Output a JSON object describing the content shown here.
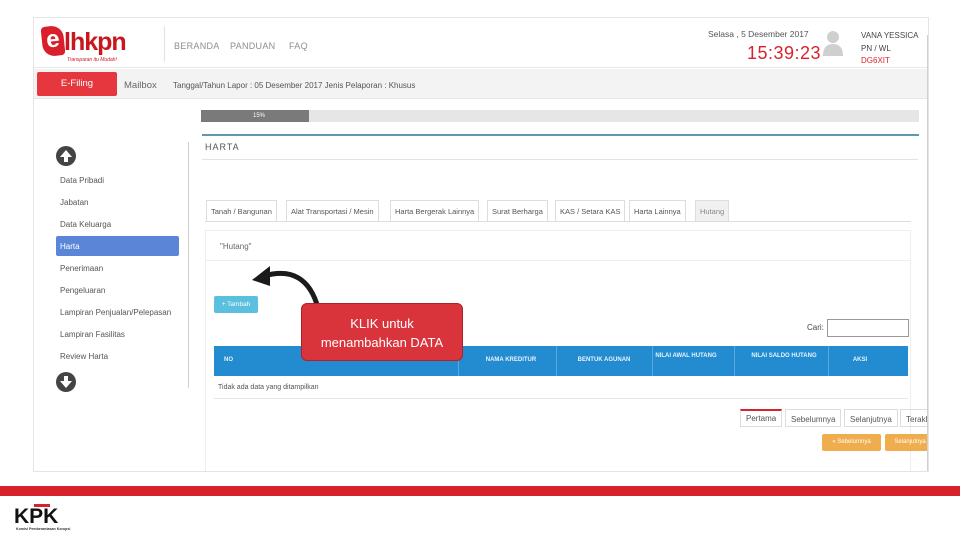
{
  "header": {
    "logo_letter": "e",
    "logo_text": "lhkpn",
    "logo_tagline": "Transparan itu Mudah!",
    "nav": [
      "BERANDA",
      "PANDUAN",
      "FAQ"
    ],
    "date": "Selasa , 5 Desember 2017",
    "time": "15:39:23",
    "user_name": "VANA YESSICA",
    "user_role": "PN / WL",
    "user_code": "DG6XIT"
  },
  "subbar": {
    "efiling": "E-Filing",
    "mailbox": "Mailbox",
    "info": "Tanggal/Tahun Lapor : 05 Desember 2017    Jenis Pelaporan : Khusus"
  },
  "sidebar": {
    "items": [
      "Data Pribadi",
      "Jabatan",
      "Data Keluarga",
      "Harta",
      "Penerimaan",
      "Pengeluaran",
      "Lampiran Penjualan/Pelepasan",
      "Lampiran Fasilitas",
      "Review Harta"
    ],
    "active_index": 3
  },
  "main": {
    "progress_label": "15%",
    "progress_value": 0.15,
    "section_title": "HARTA",
    "tabs": [
      "Tanah / Bangunan",
      "Alat Transportasi / Mesin",
      "Harta Bergerak Lainnya",
      "Surat Berharga",
      "KAS / Setara KAS",
      "Harta Lainnya",
      "Hutang"
    ],
    "active_tab": 6,
    "table_caption": "\"Hutang\"",
    "add_button": "+ Tambah",
    "search_label": "Cari:",
    "columns": [
      "NO",
      "NAMA KREDITUR",
      "BENTUK AGUNAN",
      "NILAI AWAL HUTANG",
      "NILAI SALDO HUTANG",
      "AKSI"
    ],
    "empty_text": "Tidak ada data yang ditampilkan",
    "pager": [
      "Pertama",
      "Sebelumnya",
      "Selanjutnya",
      "Terakhir"
    ],
    "prev_button": "« Sebelumnya",
    "next_button": "Selanjutnya »"
  },
  "callout": {
    "line1": "KLIK untuk",
    "line2": "menambahkan DATA"
  },
  "footer": {
    "logo_text": "KPK",
    "logo_sub": "Komisi Pemberantasan Korupsi"
  },
  "colors": {
    "brand_red": "#d9232c",
    "table_header": "#238bd0",
    "sidebar_active": "#5b86d8",
    "add_button": "#5bc0de",
    "nav_button": "#f0ad4e"
  }
}
